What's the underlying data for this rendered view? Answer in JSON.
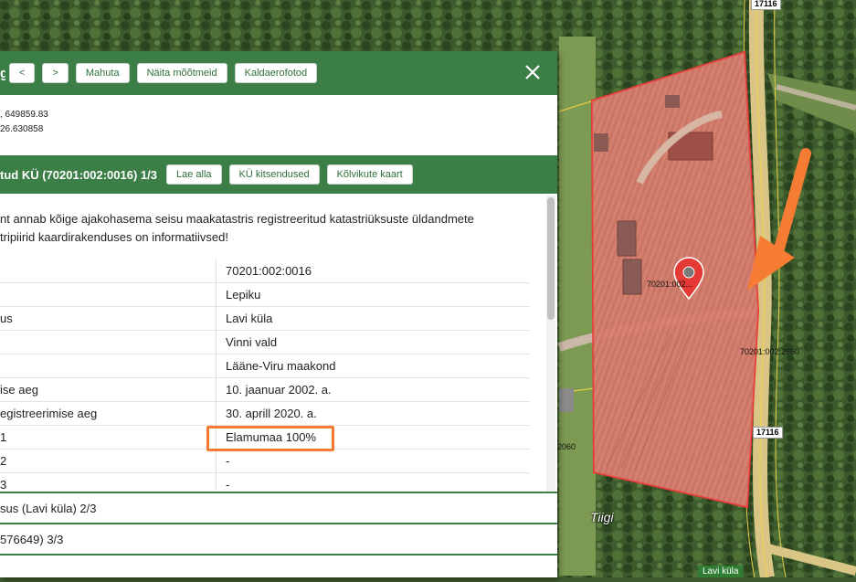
{
  "header": {
    "title": "g",
    "buttons": {
      "prev": "<",
      "next": ">",
      "fit": "Mahuta",
      "dimensions": "Näita mõõtmeid",
      "oblique": "Kaldaerofotod"
    }
  },
  "coords": {
    "line1": ", 649859.83",
    "line2": "26.630858"
  },
  "section": {
    "title": "tud KÜ (70201:002:0016) 1/3",
    "buttons": {
      "download": "Lae alla",
      "restrictions": "KÜ kitsendused",
      "soil_map": "Kõlvikute kaart"
    }
  },
  "intro": {
    "line1": "nt annab kõige ajakohasema seisu maakatastris registreeritud katastriüksuste üldandmete",
    "line2": "tripiirid kaardirakenduses on informatiivsed!"
  },
  "attributes": [
    {
      "key": "",
      "value": "70201:002:0016"
    },
    {
      "key": "",
      "value": "Lepiku"
    },
    {
      "key": "us",
      "value": "Lavi küla"
    },
    {
      "key": "",
      "value": "Vinni vald"
    },
    {
      "key": "",
      "value": "Lääne-Viru maakond"
    },
    {
      "key": "ise aeg",
      "value": "10. jaanuar 2002. a."
    },
    {
      "key": "egistreerimise aeg",
      "value": "30. aprill 2020. a."
    },
    {
      "key": "1",
      "value": "Elamumaa 100%"
    },
    {
      "key": "2",
      "value": "-"
    },
    {
      "key": "3",
      "value": "-"
    }
  ],
  "collapsed": {
    "row1": "sus (Lavi küla) 2/3",
    "row2": "576649) 3/3"
  },
  "map": {
    "parcel_label": "70201:002...",
    "parcel_label_east": "70201:002:2660",
    "parcel_label_west": "2060",
    "road_top": "17116",
    "road_mid": "17116",
    "street": "Tiigi",
    "village": "Lavi küla"
  },
  "colors": {
    "panel_green": "#3b7f47",
    "parcel_red": "#e53935",
    "highlight_orange": "#f57c32"
  }
}
